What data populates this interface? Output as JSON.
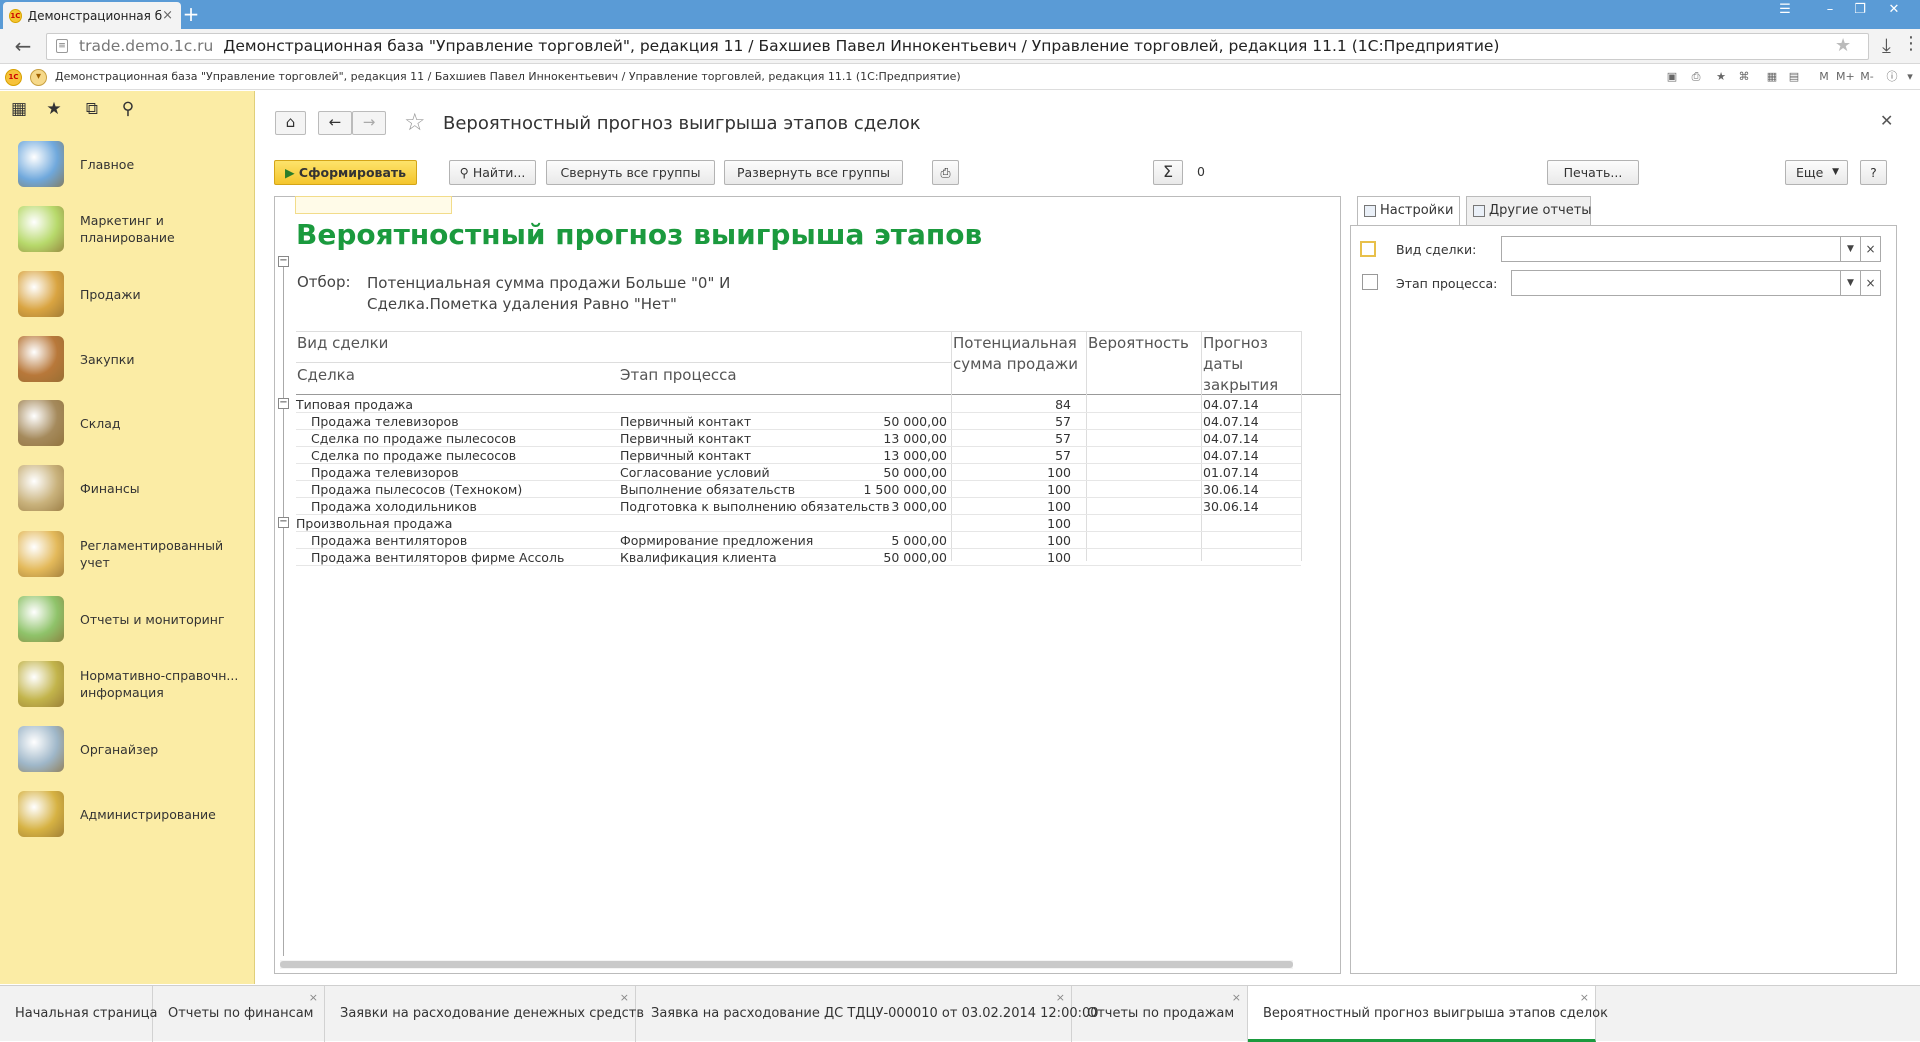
{
  "browser": {
    "tab_title": "Демонстрационная б",
    "favicon": "1С",
    "url_domain": "trade.demo.1c.ru",
    "url_title": "Демонстрационная база \"Управление торговлей\", редакция 11 / Бахшиев Павел Иннокентьевич / Управление торговлей, редакция 11.1 (1С:Предприятие)"
  },
  "app": {
    "title": "Демонстрационная база \"Управление торговлей\", редакция 11 / Бахшиев Павел Иннокентьевич / Управление торговлей, редакция 11.1  (1С:Предприятие)",
    "tool_labels": [
      "M",
      "M+",
      "M-"
    ]
  },
  "sidebar": {
    "icons": [
      "apps-grid-icon",
      "favorites-star-icon",
      "history-icon",
      "search-icon"
    ],
    "sections": [
      {
        "label": "Главное",
        "icon": "home-desk-icon",
        "color": "#6fa8dc"
      },
      {
        "label": "Маркетинг и\nпланирование",
        "icon": "pie-chart-icon",
        "color": "#b7d96b"
      },
      {
        "label": "Продажи",
        "icon": "truck-icon",
        "color": "#d9a441"
      },
      {
        "label": "Закупки",
        "icon": "boxes-icon",
        "color": "#b8783a"
      },
      {
        "label": "Склад",
        "icon": "warehouse-shelf-icon",
        "color": "#a58a5c"
      },
      {
        "label": "Финансы",
        "icon": "coins-icon",
        "color": "#c9b27c"
      },
      {
        "label": "Регламентированный\nучет",
        "icon": "ledger-icon",
        "color": "#e3b95a"
      },
      {
        "label": "Отчеты и мониторинг",
        "icon": "bar-chart-icon",
        "color": "#8fc36a"
      },
      {
        "label": "Нормативно-справочн...\nинформация",
        "icon": "binders-icon",
        "color": "#c2b44b"
      },
      {
        "label": "Органайзер",
        "icon": "checklist-icon",
        "color": "#9fb7c9"
      },
      {
        "label": "Администрирование",
        "icon": "database-icon",
        "color": "#d6b243"
      }
    ]
  },
  "form": {
    "title": "Вероятностный прогноз выигрыша этапов сделок",
    "buttons": {
      "generate": "Сформировать",
      "find": "Найти...",
      "collapse": "Свернуть все группы",
      "expand": "Развернуть все группы",
      "print": "Печать...",
      "more": "Еще",
      "help": "?"
    },
    "sum_value": "0"
  },
  "report": {
    "title": "Вероятностный прогноз выигрыша этапов",
    "filter_label": "Отбор:",
    "filter_lines": [
      "Потенциальная сумма продажи Больше \"0\" И",
      "Сделка.Пометка удаления Равно \"Нет\""
    ],
    "headers": {
      "deal_type": "Вид сделки",
      "deal": "Сделка",
      "stage": "Этап процесса",
      "amount": "Потенциальная\nсумма продажи",
      "probability": "Вероятность",
      "forecast": "Прогноз\nдаты\nзакрытия"
    },
    "rows": [
      {
        "level": 0,
        "deal": "Типовая продажа",
        "stage": "",
        "amount": "",
        "prob": "84",
        "date": "04.07.14"
      },
      {
        "level": 1,
        "deal": "Продажа телевизоров",
        "stage": "Первичный контакт",
        "amount": "50 000,00",
        "prob": "57",
        "date": "04.07.14"
      },
      {
        "level": 1,
        "deal": "Сделка по продаже пылесосов",
        "stage": "Первичный контакт",
        "amount": "13 000,00",
        "prob": "57",
        "date": "04.07.14"
      },
      {
        "level": 1,
        "deal": "Сделка по продаже пылесосов",
        "stage": "Первичный контакт",
        "amount": "13 000,00",
        "prob": "57",
        "date": "04.07.14"
      },
      {
        "level": 1,
        "deal": "Продажа телевизоров",
        "stage": "Согласование условий",
        "amount": "50 000,00",
        "prob": "100",
        "date": "01.07.14"
      },
      {
        "level": 1,
        "deal": "Продажа пылесосов (Техноком)",
        "stage": "Выполнение обязательств",
        "amount": "1 500 000,00",
        "prob": "100",
        "date": "30.06.14"
      },
      {
        "level": 1,
        "deal": "Продажа холодильников",
        "stage": "Подготовка к выполнению обязательств",
        "amount": "3 000,00",
        "prob": "100",
        "date": "30.06.14"
      },
      {
        "level": 0,
        "deal": "Произвольная продажа",
        "stage": "",
        "amount": "",
        "prob": "100",
        "date": ""
      },
      {
        "level": 1,
        "deal": "Продажа вентиляторов",
        "stage": "Формирование предложения",
        "amount": "5 000,00",
        "prob": "100",
        "date": ""
      },
      {
        "level": 1,
        "deal": "Продажа вентиляторов фирме Ассоль",
        "stage": "Квалификация клиента",
        "amount": "50 000,00",
        "prob": "100",
        "date": ""
      }
    ]
  },
  "settings": {
    "tabs": [
      "Настройки",
      "Другие отчеты"
    ],
    "fields": [
      {
        "label": "Вид сделки:",
        "value": ""
      },
      {
        "label": "Этап процесса:",
        "value": ""
      }
    ]
  },
  "bottom_tabs": [
    {
      "label": "Начальная страница",
      "active": false
    },
    {
      "label": "Отчеты по финансам",
      "active": false
    },
    {
      "label": "Заявки на расходование денежных средств",
      "active": false
    },
    {
      "label": "Заявка на расходование ДС ТДЦУ-000010 от 03.02.2014 12:00:00",
      "active": false
    },
    {
      "label": "Отчеты по продажам",
      "active": false
    },
    {
      "label": "Вероятностный прогноз выигрыша этапов сделок",
      "active": true
    }
  ]
}
